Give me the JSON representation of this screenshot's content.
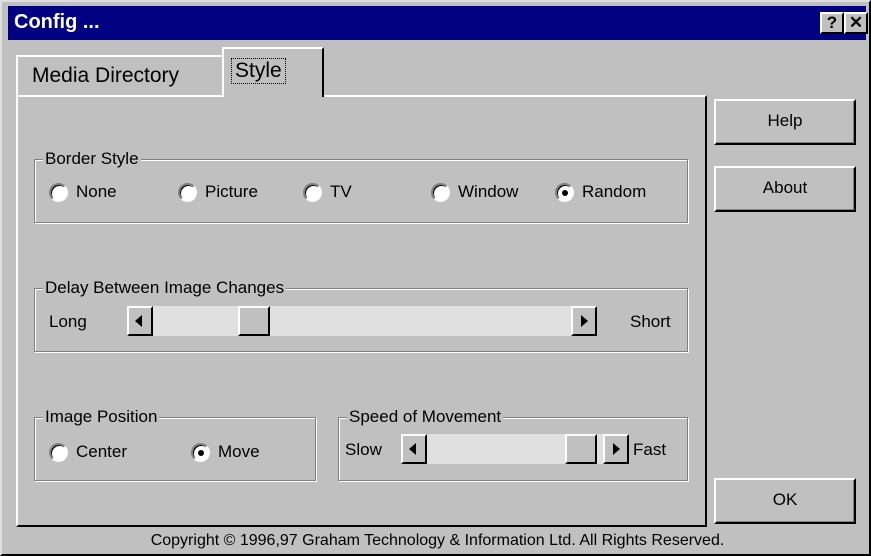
{
  "window": {
    "title": "Config ...",
    "help_glyph": "?",
    "close_glyph": "✕"
  },
  "tabs": [
    {
      "label": "Media Directory",
      "selected": false
    },
    {
      "label": "Style",
      "selected": true
    }
  ],
  "border_style": {
    "legend": "Border Style",
    "options": [
      "None",
      "Picture",
      "TV",
      "Window",
      "Random"
    ],
    "selected": "Random"
  },
  "delay": {
    "legend": "Delay Between Image Changes",
    "left_label": "Long",
    "right_label": "Short",
    "position_fraction": 0.25
  },
  "image_position": {
    "legend": "Image Position",
    "options": [
      "Center",
      "Move"
    ],
    "selected": "Move"
  },
  "speed": {
    "legend": "Speed of Movement",
    "left_label": "Slow",
    "right_label": "Fast",
    "position_fraction": 0.8
  },
  "buttons": {
    "help": "Help",
    "about": "About",
    "ok": "OK"
  },
  "footer": {
    "copyright": "Copyright © 1996,97 Graham Technology & Information Ltd. All Rights Reserved."
  },
  "colors": {
    "titlebar": "#000080",
    "face": "#c0c0c0",
    "track": "#e0e0e0"
  }
}
